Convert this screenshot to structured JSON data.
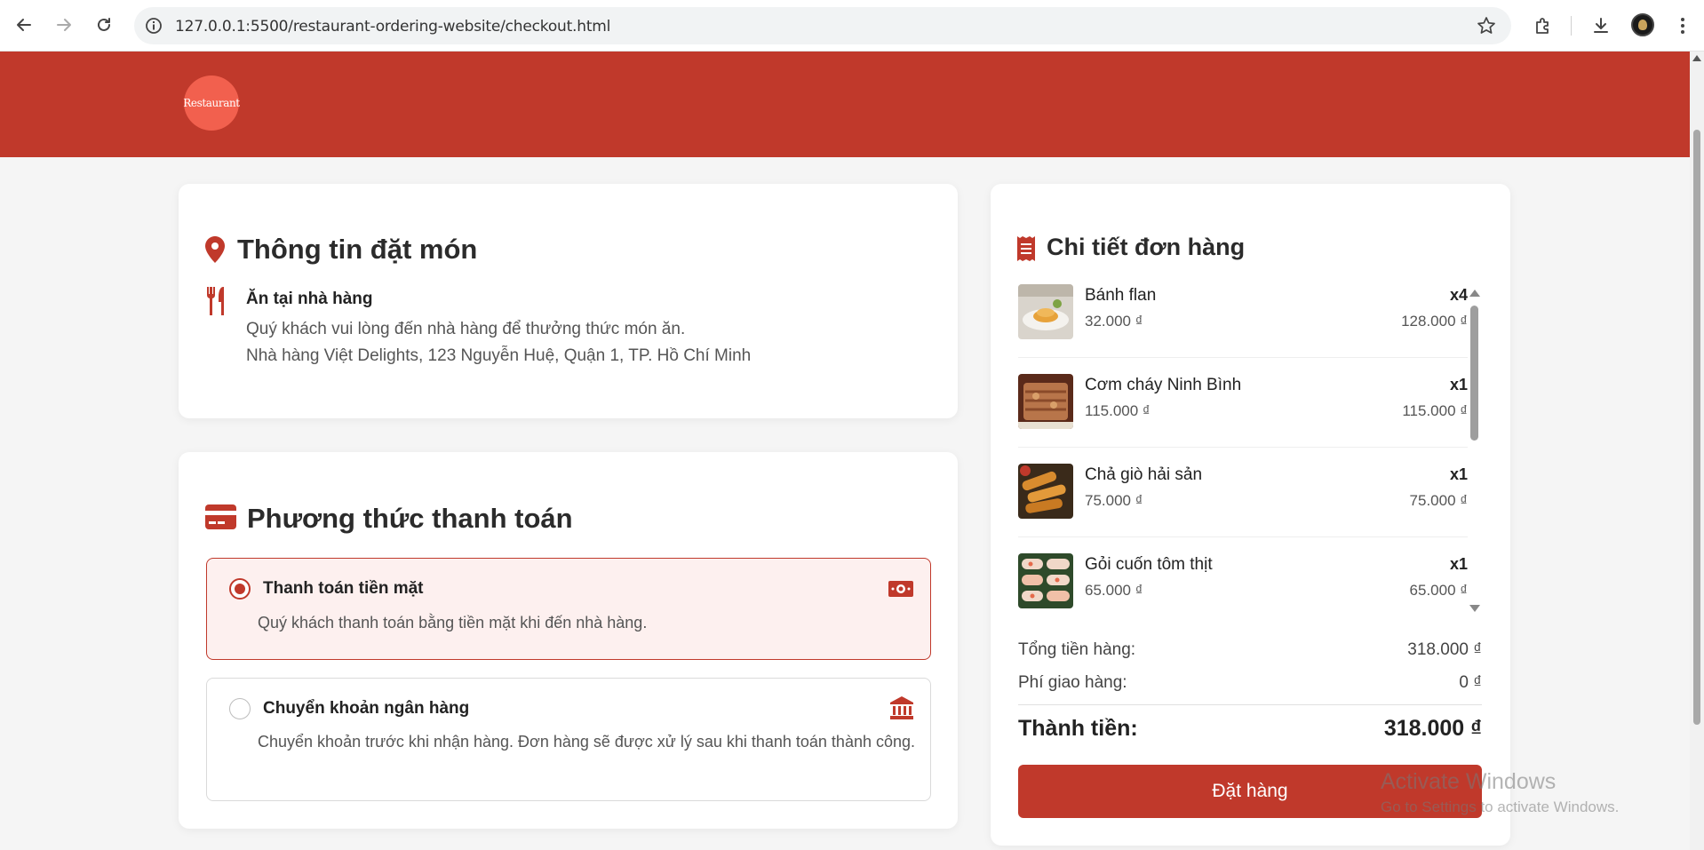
{
  "browser": {
    "url": "127.0.0.1:5500/restaurant-ordering-website/checkout.html",
    "back_icon": "arrow-left-icon",
    "forward_icon": "arrow-right-icon",
    "reload_icon": "reload-icon",
    "site_info_icon": "info-circle-icon",
    "bookmark_icon": "star-icon",
    "extensions_icon": "puzzle-icon",
    "downloads_icon": "download-icon",
    "menu_icon": "kebab-menu-icon"
  },
  "header": {
    "logo_text": "Restaurant",
    "band_color": "#c0392b",
    "logo_color": "#f2604e"
  },
  "order_info": {
    "title": "Thông tin đặt món",
    "title_icon": "map-pin-icon",
    "mode_icon": "utensils-icon",
    "mode_title": "Ăn tại nhà hàng",
    "mode_note": "Quý khách vui lòng đến nhà hàng để thưởng thức món ăn.",
    "address": "Nhà hàng Việt Delights, 123 Nguyễn Huệ, Quận 1, TP. Hồ Chí Minh"
  },
  "payment": {
    "title": "Phương thức thanh toán",
    "title_icon": "credit-card-icon",
    "options": [
      {
        "name": "Thanh toán tiền mặt",
        "desc": "Quý khách thanh toán bằng tiền mặt khi đến nhà hàng.",
        "icon": "money-bill-icon",
        "selected": true
      },
      {
        "name": "Chuyển khoản ngân hàng",
        "desc": "Chuyển khoản trước khi nhận hàng. Đơn hàng sẽ được xử lý sau khi thanh toán thành công.",
        "icon": "bank-icon",
        "selected": false
      }
    ]
  },
  "order_details": {
    "title": "Chi tiết đơn hàng",
    "title_icon": "receipt-icon",
    "items": [
      {
        "name": "Bánh flan",
        "price": "32.000 ₫",
        "qty": "x4",
        "total": "128.000 ₫"
      },
      {
        "name": "Cơm cháy Ninh Bình",
        "price": "115.000 ₫",
        "qty": "x1",
        "total": "115.000 ₫"
      },
      {
        "name": "Chả giò hải sản",
        "price": "75.000 ₫",
        "qty": "x1",
        "total": "75.000 ₫"
      },
      {
        "name": "Gỏi cuốn tôm thịt",
        "price": "65.000 ₫",
        "qty": "x1",
        "total": "65.000 ₫"
      }
    ],
    "subtotal_label": "Tổng tiền hàng:",
    "subtotal_value": "318.000 ₫",
    "shipping_label": "Phí giao hàng:",
    "shipping_value": "0 ₫",
    "grand_label": "Thành tiền:",
    "grand_value": "318.000 ₫",
    "order_button": "Đặt hàng"
  },
  "watermark": {
    "line1": "Activate Windows",
    "line2": "Go to Settings to activate Windows."
  }
}
